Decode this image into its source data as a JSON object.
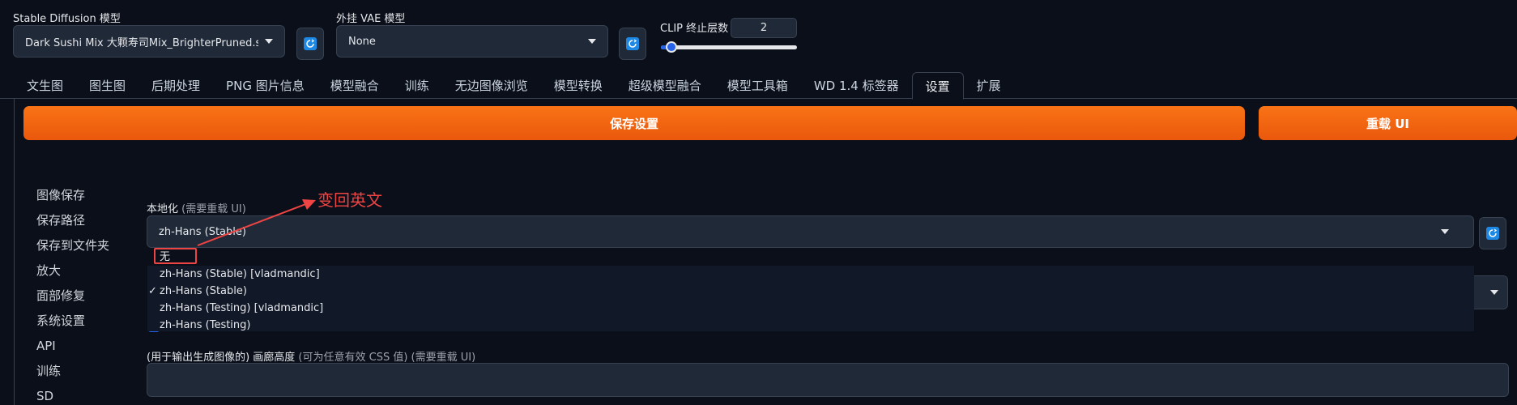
{
  "top": {
    "sd_model_label": "Stable Diffusion 模型",
    "sd_model_value": "Dark Sushi Mix 大颗寿司Mix_BrighterPruned.sa",
    "vae_label": "外挂 VAE 模型",
    "vae_value": "None",
    "clip_label": "CLIP 终止层数",
    "clip_value": "2",
    "clip_slider_fraction": 0.08
  },
  "tabs": [
    {
      "label": "文生图"
    },
    {
      "label": "图生图"
    },
    {
      "label": "后期处理"
    },
    {
      "label": "PNG 图片信息"
    },
    {
      "label": "模型融合"
    },
    {
      "label": "训练"
    },
    {
      "label": "无边图像浏览"
    },
    {
      "label": "模型转换"
    },
    {
      "label": "超级模型融合"
    },
    {
      "label": "模型工具箱"
    },
    {
      "label": "WD 1.4 标签器"
    },
    {
      "label": "设置"
    },
    {
      "label": "扩展"
    }
  ],
  "buttons": {
    "save": "保存设置",
    "reload": "重载 UI"
  },
  "sidebar": [
    {
      "label": "图像保存"
    },
    {
      "label": "保存路径"
    },
    {
      "label": "保存到文件夹"
    },
    {
      "label": "放大"
    },
    {
      "label": "面部修复"
    },
    {
      "label": "系统设置"
    },
    {
      "label": "API"
    },
    {
      "label": "训练"
    },
    {
      "label": "SD"
    }
  ],
  "localization": {
    "label": "本地化",
    "label_note": "(需要重载 UI)",
    "value": "zh-Hans (Stable)",
    "options": [
      {
        "label": "无",
        "checked": false
      },
      {
        "label": "zh-Hans (Stable) [vladmandic]",
        "checked": false
      },
      {
        "label": "zh-Hans (Stable)",
        "checked": true
      },
      {
        "label": "zh-Hans (Testing) [vladmandic]",
        "checked": false
      },
      {
        "label": "zh-Hans (Testing)",
        "checked": false
      }
    ],
    "check_mark": "✓"
  },
  "annotation": {
    "text": "变回英文",
    "color": "#ef4444"
  },
  "gallery_height": {
    "label_prefix": "(用于输出生成图像的) 画廊高度",
    "label_note": "(可为任意有效 CSS 值) (需要重载 UI)"
  },
  "colors": {
    "background": "#0b0f19",
    "accent_orange": "#f97316",
    "accent_blue": "#2563eb"
  }
}
